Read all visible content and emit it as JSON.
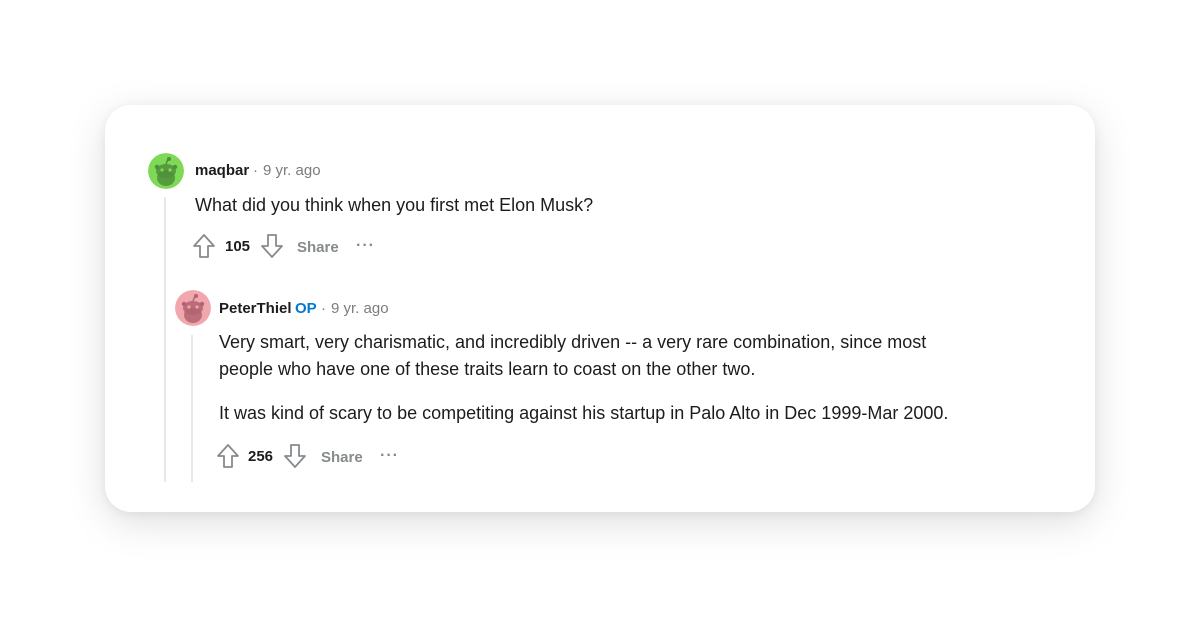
{
  "comments": [
    {
      "username": "maqbar",
      "separator": "·",
      "time": "9 yr. ago",
      "avatar_color": "#7ed957",
      "paragraphs": [
        "What did you think when you first met Elon Musk?"
      ],
      "score": "105",
      "share_label": "Share",
      "more_label": "···"
    },
    {
      "username": "PeterThiel",
      "op_badge": "OP",
      "separator": "·",
      "time": "9 yr. ago",
      "avatar_color": "#f1a7ad",
      "paragraphs": [
        "Very smart, very charismatic, and incredibly driven -- a very rare combination, since most people who have one of these traits learn to coast on the other two.",
        "It was kind of scary to be competiting against his startup in Palo Alto in Dec 1999-Mar 2000."
      ],
      "score": "256",
      "share_label": "Share",
      "more_label": "···"
    }
  ],
  "icons": {
    "avatar": "reddit-snoo-icon",
    "upvote": "arrow-up-icon",
    "downvote": "arrow-down-icon",
    "more": "ellipsis-icon"
  },
  "colors": {
    "op_badge": "#0079d3",
    "meta": "#7c7c7c",
    "action": "#878a8c"
  }
}
